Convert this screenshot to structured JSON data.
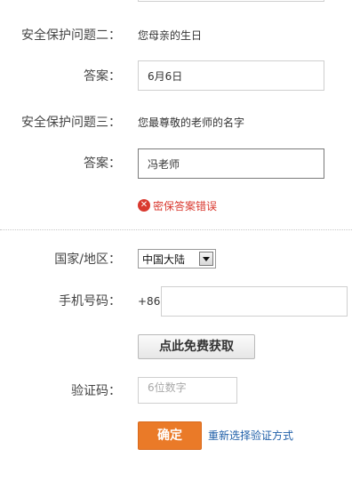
{
  "security": {
    "question2_label": "安全保护问题二：",
    "question2_text": "您母亲的生日",
    "answer2_label": "答案：",
    "answer2_value": "6月6日",
    "question3_label": "安全保护问题三：",
    "question3_text": "您最尊敬的老师的名字",
    "answer3_label": "答案：",
    "answer3_value": "冯老师",
    "error_icon": "x-circle-icon",
    "error_text": "密保答案错误",
    "error_color": "#d9392f"
  },
  "phone": {
    "country_label": "国家/地区：",
    "country_value": "中国大陆",
    "number_label": "手机号码：",
    "prefix": "+86",
    "number_value": "",
    "get_code_button": "点此免费获取",
    "code_label": "验证码：",
    "code_placeholder": "6位数字"
  },
  "actions": {
    "confirm_button": "确定",
    "confirm_color": "#ea7a28",
    "reselect_link": "重新选择验证方式",
    "link_color": "#1f5fa8"
  }
}
